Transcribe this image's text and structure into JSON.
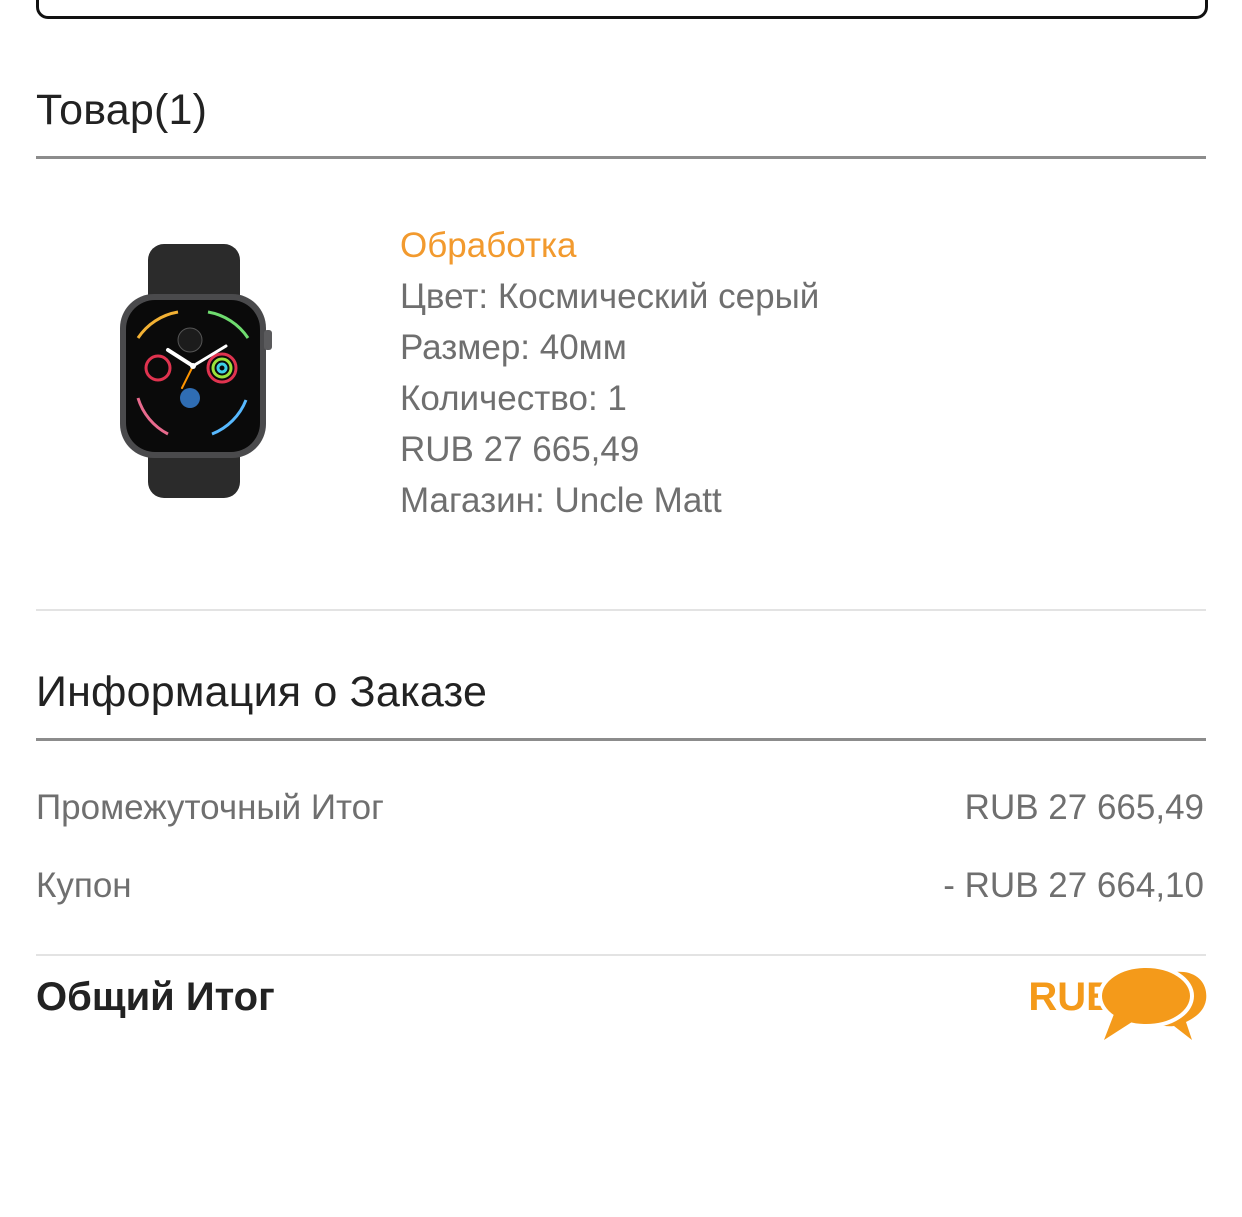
{
  "product_section": {
    "title": "Товар(1)",
    "item": {
      "image": "apple-watch-space-gray",
      "status": "Обработка",
      "color": "Цвет: Космический серый",
      "size": "Размер: 40мм",
      "quantity": "Количество: 1",
      "price": "RUB 27 665,49",
      "store": "Магазин: Uncle Matt"
    }
  },
  "order_info": {
    "title": "Информация о Заказе",
    "subtotal_label": "Промежуточный Итог",
    "subtotal_value": "RUB 27 665,49",
    "coupon_label": "Купон",
    "coupon_value": "- RUB 27 664,10",
    "total_label": "Общий Итог",
    "total_value": "RUB 1,39"
  },
  "colors": {
    "accent": "#f49a1a",
    "status": "#f29a2e",
    "text": "#6f6f6f"
  },
  "icons": {
    "chat": "chat-bubbles-icon"
  }
}
